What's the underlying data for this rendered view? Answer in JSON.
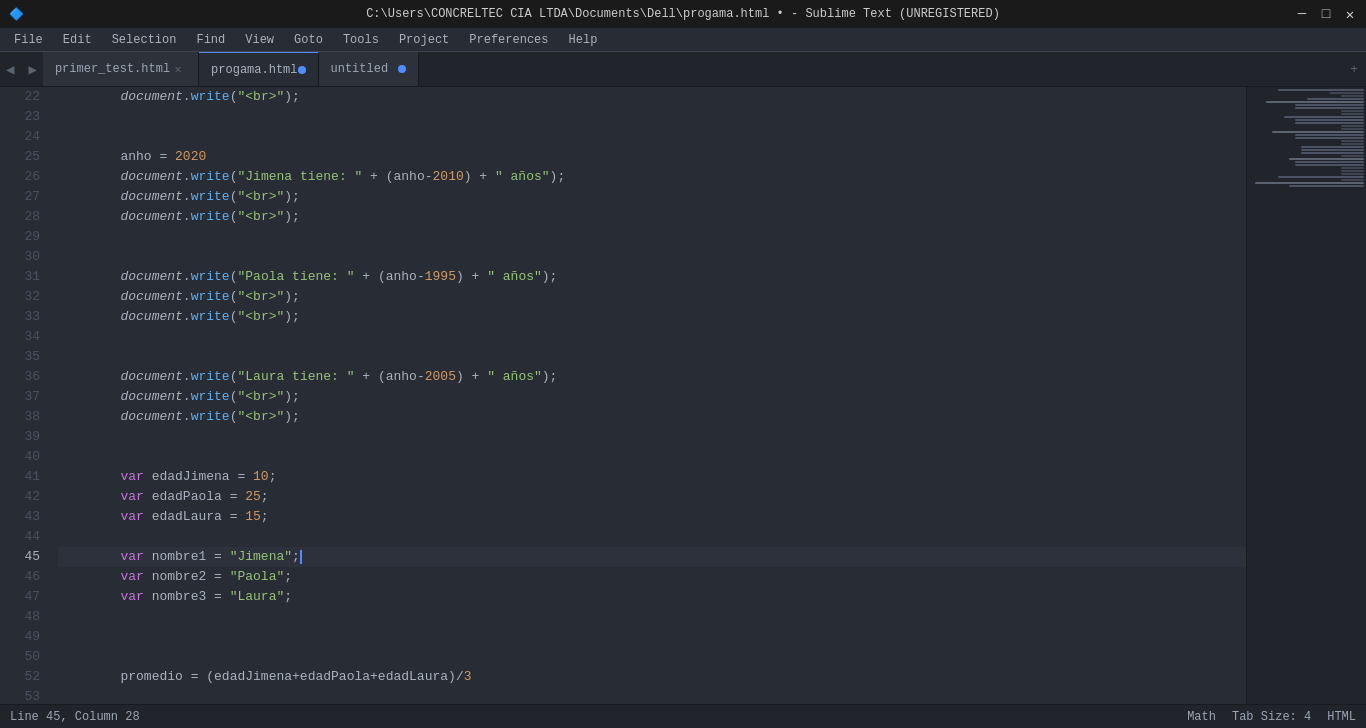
{
  "titlebar": {
    "icon": "🔷",
    "text": "C:\\Users\\CONCRELTEC CIA LTDA\\Documents\\Dell\\progama.html • - Sublime Text (UNREGISTERED)",
    "minimize": "─",
    "maximize": "□",
    "close": "✕"
  },
  "menubar": {
    "items": [
      "File",
      "Edit",
      "Selection",
      "Find",
      "View",
      "Goto",
      "Tools",
      "Project",
      "Preferences",
      "Help"
    ]
  },
  "tabs": [
    {
      "label": "primer_test.html",
      "active": false,
      "has_dot": false,
      "has_close": true
    },
    {
      "label": "progama.html",
      "active": true,
      "has_dot": true,
      "has_close": false
    },
    {
      "label": "untitled",
      "active": false,
      "has_dot": true,
      "has_close": false
    }
  ],
  "statusbar": {
    "left": "Line 45, Column 28",
    "tab_size": "Tab Size: 4",
    "lang": "HTML",
    "math": "Math"
  },
  "lines": {
    "start": 22,
    "active": 45
  }
}
